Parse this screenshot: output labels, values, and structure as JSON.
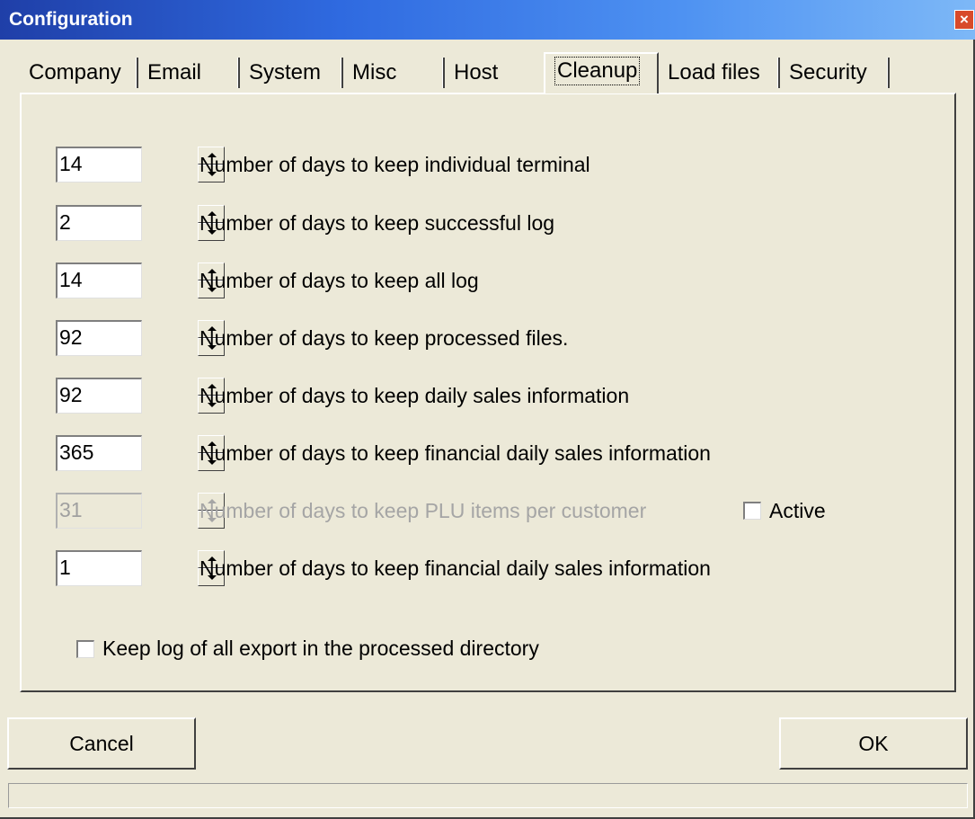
{
  "window": {
    "title": "Configuration",
    "close_glyph": "×"
  },
  "tabs": [
    {
      "label": "Company"
    },
    {
      "label": "Email"
    },
    {
      "label": "System"
    },
    {
      "label": "Misc"
    },
    {
      "label": "Host"
    },
    {
      "label": "Cleanup",
      "active": true
    },
    {
      "label": "Load files"
    },
    {
      "label": "Security"
    }
  ],
  "rows": [
    {
      "value": "14",
      "label": "Number of days to keep individual terminal",
      "enabled": true
    },
    {
      "value": "2",
      "label": "Number of days to keep successful log",
      "enabled": true
    },
    {
      "value": "14",
      "label": "Number of days to keep all log",
      "enabled": true
    },
    {
      "value": "92",
      "label": "Number of days to keep processed files.",
      "enabled": true
    },
    {
      "value": "92",
      "label": "Number of days to keep daily sales information",
      "enabled": true
    },
    {
      "value": "365",
      "label": "Number of days to keep financial daily sales information",
      "enabled": true
    },
    {
      "value": "31",
      "label": "Number of days to keep PLU items per customer",
      "enabled": false,
      "checkbox_label": "Active",
      "checked": false
    },
    {
      "value": "1",
      "label": "Number of days to keep financial daily sales information",
      "enabled": true
    }
  ],
  "keep_log_checkbox": {
    "label": "Keep log of all export in the processed directory",
    "checked": false
  },
  "buttons": {
    "cancel": "Cancel",
    "ok": "OK"
  },
  "icons": {
    "spin_up": "spin-up-arrow-icon",
    "spin_down": "spin-down-arrow-icon",
    "close": "close-icon"
  },
  "colors": {
    "window_bg": "#ece9d8",
    "titlebar_start": "#1f3fa8",
    "titlebar_end": "#7db8f7",
    "close_button": "#d84a2a",
    "disabled_text": "#a5a5a5"
  }
}
